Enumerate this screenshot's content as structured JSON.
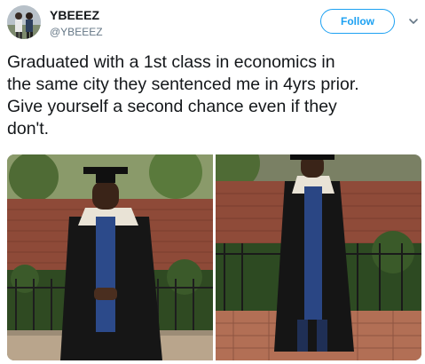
{
  "tweet": {
    "display_name": "YBEEEZ",
    "handle": "@YBEEEZ",
    "follow_label": "Follow",
    "text": "Graduated with a 1st class in economics in\nthe same city they sentenced me in 4yrs prior.\nGive yourself a second chance even if they\ndon't.",
    "avatar_icon": "user-avatar",
    "menu_icon": "chevron-down-icon"
  },
  "media": {
    "photo_count": 2
  },
  "colors": {
    "brand": "#1da1f2",
    "text": "#14171a",
    "secondary": "#657786"
  }
}
